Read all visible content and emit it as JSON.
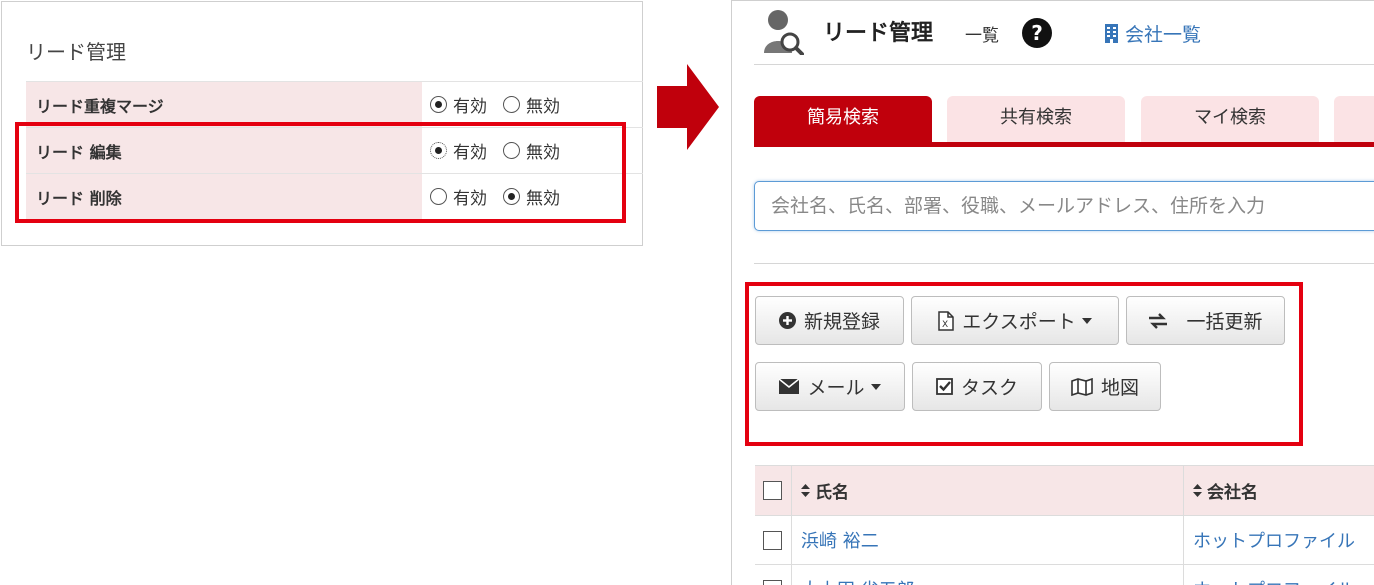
{
  "settings": {
    "title": "リード管理",
    "rows": [
      {
        "label": "リード重複マージ",
        "options": [
          "有効",
          "無効"
        ],
        "selected": "有効"
      },
      {
        "label": "リード 編集",
        "options": [
          "有効",
          "無効"
        ],
        "selected": "有効"
      },
      {
        "label": "リード 削除",
        "options": [
          "有効",
          "無効"
        ],
        "selected": "無効"
      }
    ]
  },
  "header": {
    "title": "リード管理",
    "subtitle": "一覧",
    "help_glyph": "?",
    "company_link": "会社一覧"
  },
  "tabs": [
    {
      "label": "簡易検索",
      "active": true
    },
    {
      "label": "共有検索",
      "active": false
    },
    {
      "label": "マイ検索",
      "active": false
    }
  ],
  "search": {
    "placeholder": "会社名、氏名、部署、役職、メールアドレス、住所を入力"
  },
  "toolbar": {
    "new_label": "新規登録",
    "export_label": "エクスポート",
    "bulk_update_label": "一括更新",
    "mail_label": "メール",
    "task_label": "タスク",
    "map_label": "地図"
  },
  "table": {
    "columns": [
      "氏名",
      "会社名"
    ],
    "rows": [
      {
        "name": "浜崎 裕二",
        "company": "ホットプロファイル"
      },
      {
        "name": "大上田 省五郎",
        "company": "ホットプロファイル"
      }
    ]
  },
  "colors": {
    "accent_red": "#c0000c",
    "highlight_red": "#e40010",
    "link_blue": "#3775b8",
    "pink_label_bg": "#f7e6e7"
  }
}
